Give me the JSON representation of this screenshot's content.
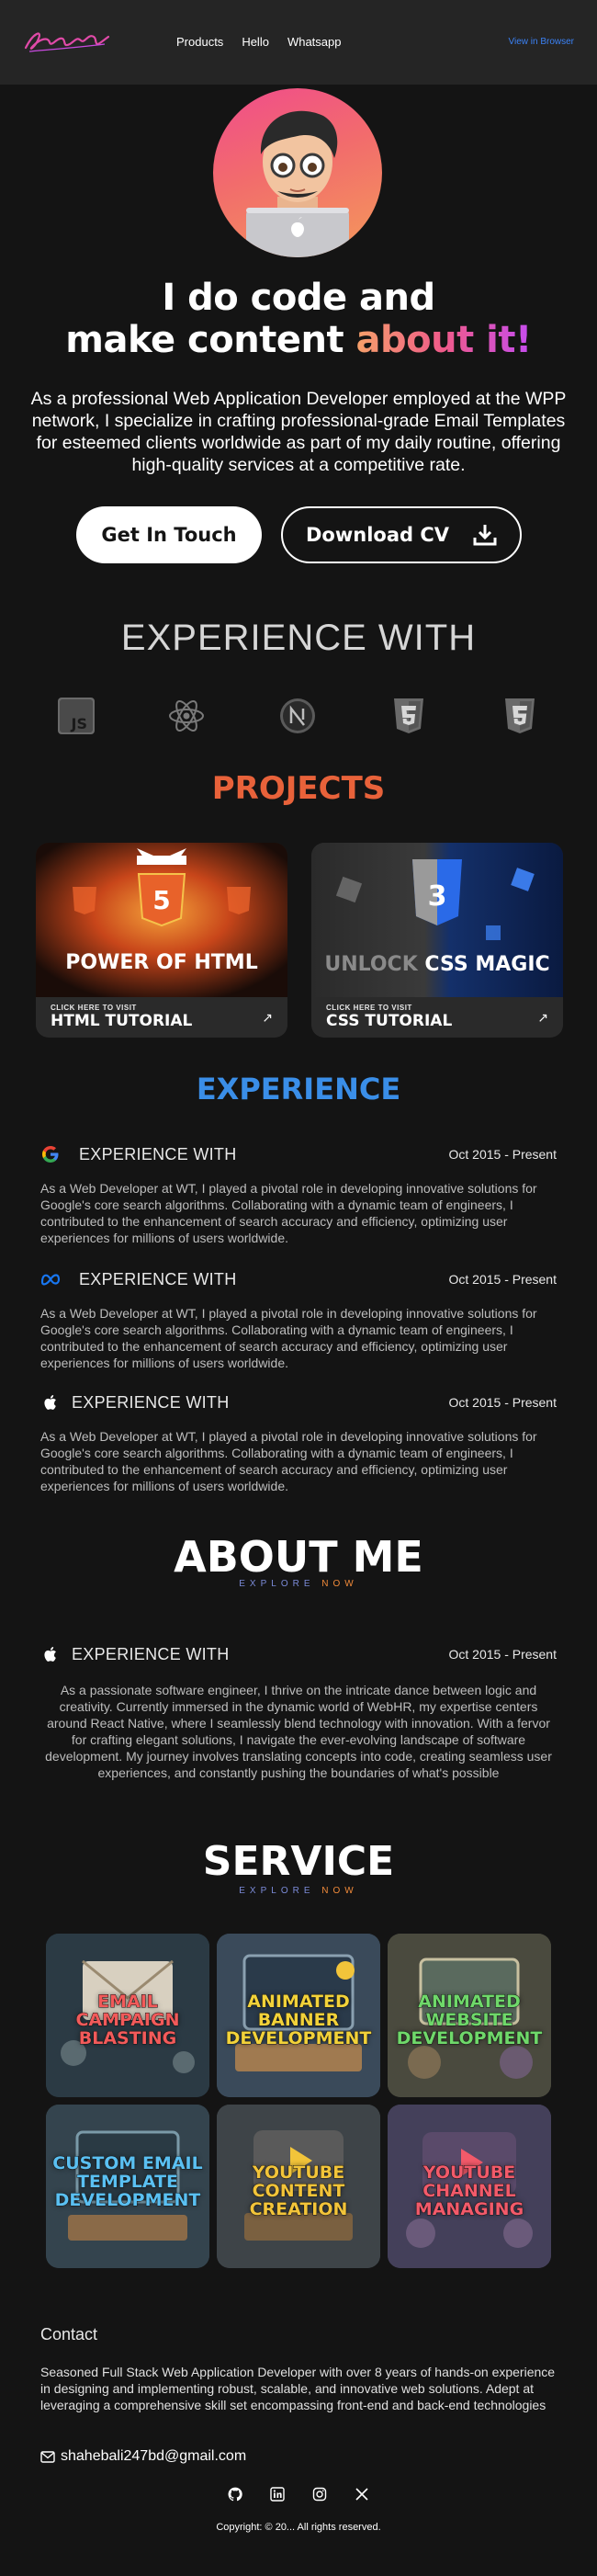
{
  "header": {
    "logo_text": "Shaheb",
    "nav": [
      "Products",
      "Hello",
      "Whatsapp"
    ],
    "view_in_browser": "View in Browser"
  },
  "hero": {
    "title_line1": "I do code and",
    "title_line2_plain": "make content ",
    "title_line2_accent": "about it!",
    "description": "As a professional Web Application Developer employed at the WPP network, I specialize in crafting professional-grade Email Templates for esteemed clients worldwide as part of my daily routine, offering high-quality services at a competitive rate.",
    "btn_touch": "Get In Touch",
    "btn_cv": "Download CV"
  },
  "experience_with": {
    "heading": "EXPERIENCE WITH",
    "icons": [
      "js-icon",
      "react-icon",
      "nextjs-icon",
      "html5-icon",
      "css3-icon"
    ]
  },
  "projects": {
    "title": "PROJECTS",
    "cards": [
      {
        "kicker": "CLICK HERE TO VISIT",
        "name": "HTML TUTORIAL",
        "overlay": "POWER OF HTML"
      },
      {
        "kicker": "CLICK HERE TO VISIT",
        "name": "CSS TUTORIAL",
        "overlay_a": "UNLOCK",
        "overlay_b": "CSS MAGIC"
      }
    ]
  },
  "experience": {
    "title": "EXPERIENCE",
    "items": [
      {
        "logo": "google-icon",
        "title": "EXPERIENCE WITH",
        "date": "Oct 2015 - Present",
        "desc": "As a Web Developer at WT, I played a pivotal role in developing innovative solutions for Google's core search algorithms. Collaborating with a dynamic team of engineers, I contributed to the enhancement of search accuracy and efficiency, optimizing user experiences for millions of users worldwide."
      },
      {
        "logo": "meta-icon",
        "title": "EXPERIENCE WITH",
        "date": "Oct 2015 - Present",
        "desc": "As a Web Developer at WT, I played a pivotal role in developing innovative solutions for Google's core search algorithms. Collaborating with a dynamic team of engineers, I contributed to the enhancement of search accuracy and efficiency, optimizing user experiences for millions of users worldwide."
      },
      {
        "logo": "apple-icon",
        "title": "EXPERIENCE WITH",
        "date": "Oct 2015 - Present",
        "desc": "As a Web Developer at WT, I played a pivotal role in developing innovative solutions for Google's core search algorithms. Collaborating with a dynamic team of engineers, I contributed to the enhancement of search accuracy and efficiency, optimizing user experiences for millions of users worldwide."
      }
    ]
  },
  "about": {
    "title": "ABOUT ME",
    "explore_a": "EXPLORE",
    "explore_b": "NOW",
    "item": {
      "logo": "apple-icon",
      "title": "EXPERIENCE WITH",
      "date": "Oct 2015 - Present"
    },
    "text": "As a passionate software engineer, I thrive on the intricate dance between logic and creativity. Currently immersed in the dynamic world of WebHR, my expertise centers around React Native, where I seamlessly blend technology with innovation. With a fervor for crafting elegant solutions, I navigate the ever-evolving landscape of software development. My journey involves translating concepts into code, creating seamless user experiences, and constantly pushing the boundaries of what's possible"
  },
  "service": {
    "title": "SERVICE",
    "explore_a": "EXPLORE",
    "explore_b": "NOW",
    "items": [
      {
        "label": "EMAIL CAMPAIGN BLASTING",
        "color": "#f25a5a",
        "bg": "#2b3a44"
      },
      {
        "label": "ANIMATED BANNER DEVELOPMENT",
        "color": "#f2d23a",
        "bg": "#3a4a5a"
      },
      {
        "label": "ANIMATED WEBSITE DEVELOPMENT",
        "color": "#6fd86a",
        "bg": "#4a4a3e"
      },
      {
        "label": "CUSTOM EMAIL TEMPLATE DEVELOPMENT",
        "color": "#5ac0f2",
        "bg": "#34444e"
      },
      {
        "label": "YOUTUBE CONTENT CREATION",
        "color": "#f2c43a",
        "bg": "#3e4448"
      },
      {
        "label": "YOUTUBE CHANNEL MANAGING",
        "color": "#f25a6a",
        "bg": "#44405a"
      }
    ]
  },
  "footer": {
    "contact_title": "Contact",
    "contact_desc": "Seasoned Full Stack Web Application Developer with over 8 years of hands-on experience in designing and implementing robust, scalable, and innovative web solutions. Adept at leveraging a comprehensive skill set encompassing front-end and back-end technologies",
    "email": "shahebali247bd@gmail.com",
    "socials": [
      "github-icon",
      "linkedin-icon",
      "instagram-icon",
      "x-icon"
    ],
    "copyright": "Copyright: © 20... All rights reserved."
  },
  "colors": {
    "background": "#141414",
    "header": "#252525",
    "projects_title": "#e8623a",
    "experience_title": "#3a8ee8",
    "link": "#3b82f6"
  }
}
